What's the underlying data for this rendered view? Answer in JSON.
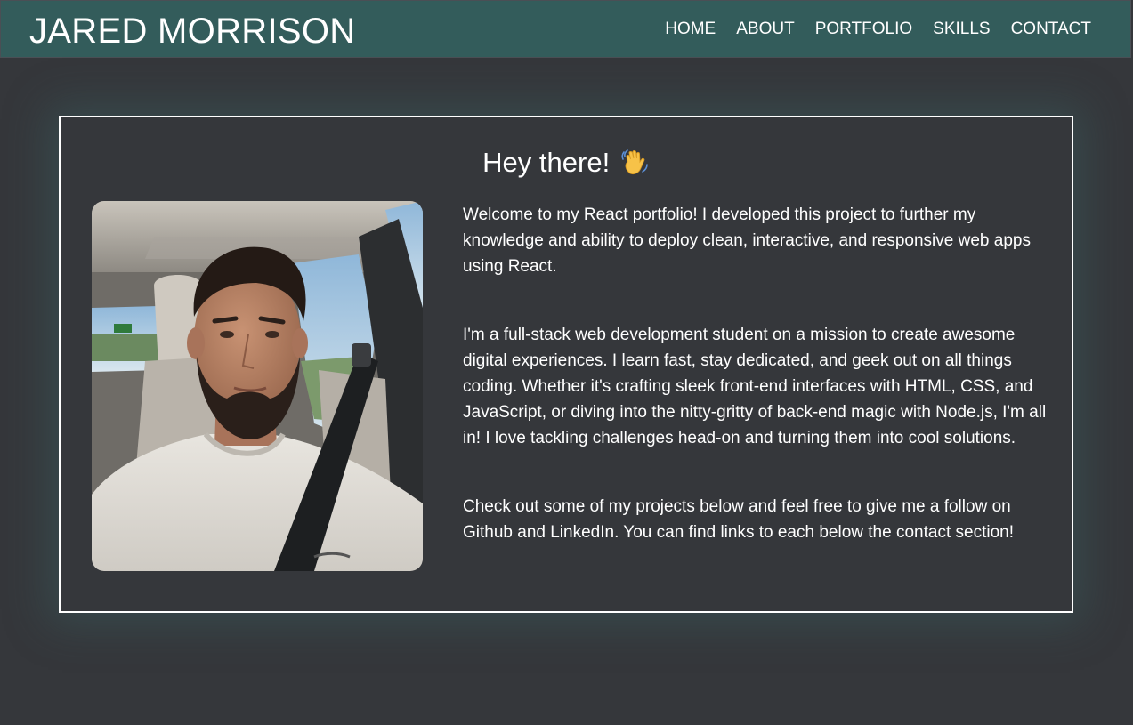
{
  "header": {
    "brand": "JARED MORRISON",
    "nav": [
      "HOME",
      "ABOUT",
      "PORTFOLIO",
      "SKILLS",
      "CONTACT"
    ]
  },
  "about": {
    "greeting": "Hey there!",
    "greeting_icon": "waving-hand-icon",
    "photo": "profile-photo",
    "paragraphs": [
      "Welcome to my React portfolio! I developed this project to further my knowledge and ability to deploy clean, interactive, and responsive web apps using React.",
      "I'm a full-stack web development student on a mission to create awesome digital experiences. I learn fast, stay dedicated, and geek out on all things coding. Whether it's crafting sleek front-end interfaces with HTML, CSS, and JavaScript, or diving into the nitty-gritty of back-end magic with Node.js, I'm all in! I love tackling challenges head-on and turning them into cool solutions.",
      "Check out some of my projects below and feel free to give me a follow on Github and LinkedIn. You can find links to each below the contact section!"
    ]
  },
  "colors": {
    "navbar": "#335c5b",
    "background": "#35373b",
    "text": "#ffffff",
    "card_border": "#ffffff"
  }
}
